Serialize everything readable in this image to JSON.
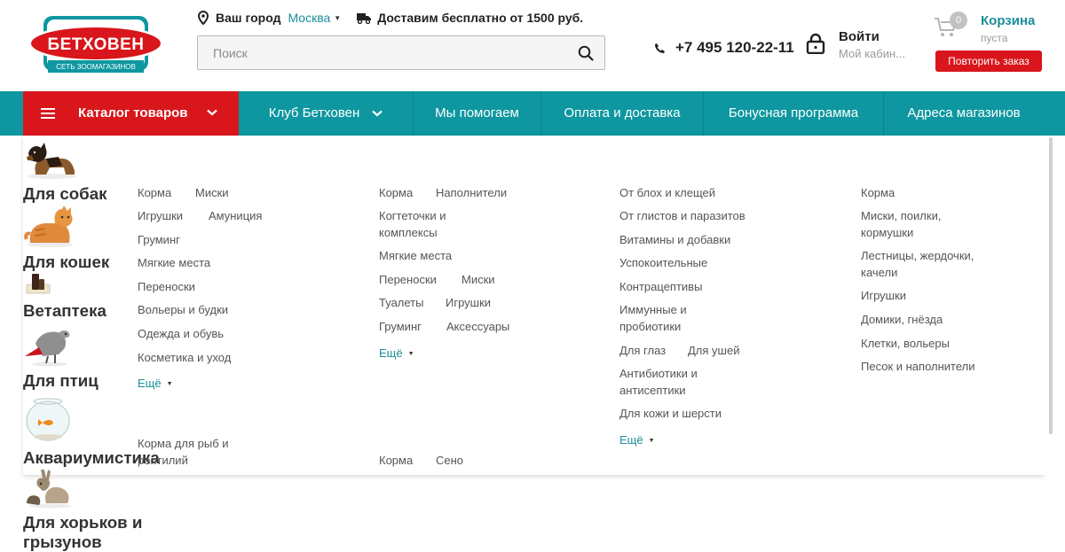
{
  "header": {
    "logo_text": "БЕТХОВЕН",
    "logo_subtitle": "СЕТЬ ЗООМАГАЗИНОВ",
    "city_label": "Ваш город",
    "city_value": "Москва",
    "delivery_text": "Доставим бесплатно от 1500 руб.",
    "search_placeholder": "Поиск",
    "phone": "+7 495 120-22-11",
    "login_title": "Войти",
    "login_sub": "Мой кабин...",
    "cart_title": "Корзина",
    "cart_sub": "пуста",
    "cart_count": "0",
    "repeat_order": "Повторить заказ"
  },
  "nav": {
    "catalog": "Каталог товаров",
    "club": "Клуб Бетховен",
    "help": "Мы помогаем",
    "payment": "Оплата и доставка",
    "bonus": "Бонусная программа",
    "stores": "Адреса магазинов"
  },
  "menu": {
    "dogs": {
      "title": "Для собак",
      "items": [
        "Корма",
        "Миски",
        "Игрушки",
        "Амуниция",
        "Груминг",
        "Мягкие места",
        "Переноски",
        "Вольеры и будки",
        "Одежда и обувь",
        "Косметика и уход"
      ],
      "more": "Ещё"
    },
    "cats": {
      "title": "Для кошек",
      "items": [
        "Корма",
        "Наполнители",
        "Когтеточки и",
        "комплексы",
        "Мягкие места",
        "Переноски",
        "Миски",
        "Туалеты",
        "Игрушки",
        "Груминг",
        "Аксессуары"
      ],
      "more": "Ещё"
    },
    "vet": {
      "title": "Ветаптека",
      "items": [
        "От блох и клещей",
        "От глистов и паразитов",
        "Витамины и добавки",
        "Успокоительные",
        "Контрацептивы",
        "Иммунные и",
        "пробиотики",
        "Для глаз",
        "Для ушей",
        "Антибиотики и",
        "антисептики",
        "Для кожи и шерсти"
      ],
      "more": "Ещё"
    },
    "birds": {
      "title": "Для птиц",
      "items": [
        "Корма",
        "Миски, поилки,",
        "кормушки",
        "Лестницы, жердочки,",
        "качели",
        "Игрушки",
        "Домики, гнёзда",
        "Клетки, вольеры",
        "Песок и наполнители"
      ]
    },
    "aqua": {
      "title": "Аквариумистика",
      "items": [
        "Корма для рыб и",
        "рептилий"
      ]
    },
    "rodents": {
      "title_line1": "Для хорьков и",
      "title_line2": "грызунов",
      "items": [
        "Корма",
        "Сено"
      ]
    }
  },
  "colors": {
    "teal": "#0e97a0",
    "red": "#d8161b",
    "link_teal": "#1a8f9a"
  }
}
